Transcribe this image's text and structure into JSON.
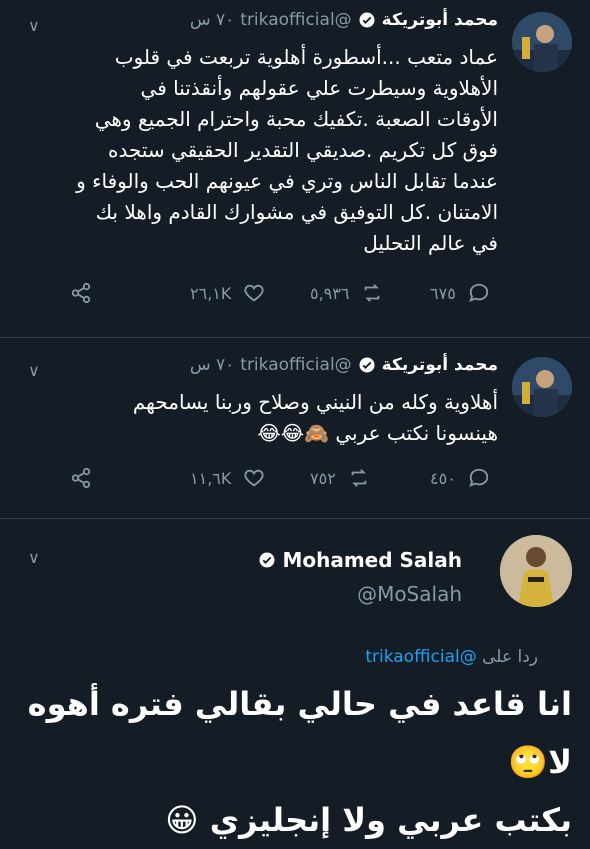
{
  "tweet1": {
    "name": "محمد أبوتريكة",
    "handle": "@trikaofficial",
    "time": "٧٠ س",
    "text": "عماد متعب ...أسطورة أهلوية تربعت في قلوب\nالأهلاوية وسيطرت علي عقولهم وأنقذتنا في\nالأوقات الصعبة .تكفيك محبة واحترام الجميع وهي\nفوق كل تكريم .صديقي التقدير الحقيقي ستجده\nعندما تقابل الناس وتري في عيونهم الحب والوفاء و\nالامتنان .كل التوفيق في مشوارك القادم واهلا بك\nفي عالم التحليل",
    "likes": "٢٦,١K",
    "retweets": "٥,٩٣٦",
    "replies": "٦٧٥"
  },
  "tweet2": {
    "name": "محمد أبوتريكة",
    "handle": "@trikaofficial",
    "time": "٧٠ س",
    "text": "أهلاوية  وكله من النيني وصلاح وربنا يسامحهم\nهينسونا نكتب عربي 🙈😂😂",
    "likes": "١١,٦K",
    "retweets": "٧٥٢",
    "replies": "٤٥٠"
  },
  "main": {
    "name": "Mohamed Salah",
    "handle": "@MoSalah",
    "replying_prefix": "ردا على",
    "replying_handle": "@trikaofficial",
    "text": "انا قاعد في حالي بقالي فتره أهوه لا🙄\nبكتب عربي ولا إنجليزي 😀"
  },
  "icons": {
    "share": "share-icon",
    "like": "heart-icon",
    "retweet": "retweet-icon",
    "reply": "reply-icon",
    "verified": "verified-badge-icon",
    "menu": "chevron-down-icon"
  },
  "colors": {
    "background": "#141d26",
    "muted": "#8899a6",
    "link": "#1da1f2",
    "divider": "#2b3a4a"
  }
}
